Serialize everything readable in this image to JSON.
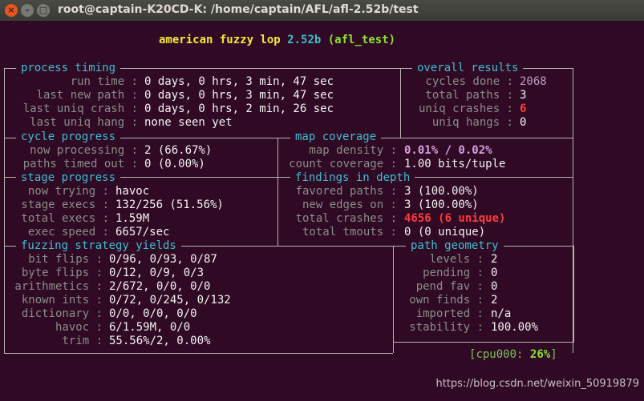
{
  "window": {
    "title": "root@captain-K20CD-K: /home/captain/AFL/afl-2.52b/test",
    "close_glyph": "×",
    "min_glyph": "–",
    "max_glyph": "□"
  },
  "banner": {
    "app": "american fuzzy lop",
    "version": "2.52b",
    "target": "(afl_test)"
  },
  "sections": {
    "process_timing": "process timing",
    "overall_results": "overall results",
    "cycle_progress": "cycle progress",
    "map_coverage": "map coverage",
    "stage_progress": "stage progress",
    "findings_in_depth": "findings in depth",
    "fuzzing_strategy_yields": "fuzzing strategy yields",
    "path_geometry": "path geometry"
  },
  "process_timing": {
    "run_time_label": "run time :",
    "run_time": "0 days, 0 hrs, 3 min, 47 sec",
    "last_new_path_label": "last new path :",
    "last_new_path": "0 days, 0 hrs, 3 min, 47 sec",
    "last_uniq_crash_label": "last uniq crash :",
    "last_uniq_crash": "0 days, 0 hrs, 2 min, 26 sec",
    "last_uniq_hang_label": "last uniq hang :",
    "last_uniq_hang": "none seen yet"
  },
  "overall_results": {
    "cycles_done_label": "cycles done :",
    "cycles_done": "2068",
    "total_paths_label": "total paths :",
    "total_paths": "3",
    "uniq_crashes_label": "uniq crashes :",
    "uniq_crashes": "6",
    "uniq_hangs_label": "uniq hangs :",
    "uniq_hangs": "0"
  },
  "cycle_progress": {
    "now_processing_label": "now processing :",
    "now_processing": "2 (66.67%)",
    "paths_timed_out_label": "paths timed out :",
    "paths_timed_out": "0 (0.00%)"
  },
  "map_coverage": {
    "map_density_label": "map density :",
    "map_density": "0.01% / 0.02%",
    "count_coverage_label": "count coverage :",
    "count_coverage": "1.00 bits/tuple"
  },
  "stage_progress": {
    "now_trying_label": "now trying :",
    "now_trying": "havoc",
    "stage_execs_label": "stage execs :",
    "stage_execs": "132/256 (51.56%)",
    "total_execs_label": "total execs :",
    "total_execs": "1.59M",
    "exec_speed_label": "exec speed :",
    "exec_speed": "6657/sec"
  },
  "findings_in_depth": {
    "favored_paths_label": "favored paths :",
    "favored_paths": "3 (100.00%)",
    "new_edges_on_label": "new edges on :",
    "new_edges_on": "3 (100.00%)",
    "total_crashes_label": "total crashes :",
    "total_crashes": "4656 (6 unique)",
    "total_tmouts_label": "total tmouts :",
    "total_tmouts": "0 (0 unique)"
  },
  "fuzzing_strategy_yields": {
    "bit_flips_label": "bit flips :",
    "bit_flips": "0/96, 0/93, 0/87",
    "byte_flips_label": "byte flips :",
    "byte_flips": "0/12, 0/9, 0/3",
    "arithmetics_label": "arithmetics :",
    "arithmetics": "2/672, 0/0, 0/0",
    "known_ints_label": "known ints :",
    "known_ints": "0/72, 0/245, 0/132",
    "dictionary_label": "dictionary :",
    "dictionary": "0/0, 0/0, 0/0",
    "havoc_label": "havoc :",
    "havoc": "6/1.59M, 0/0",
    "trim_label": "trim :",
    "trim": "55.56%/2, 0.00%"
  },
  "path_geometry": {
    "levels_label": "levels :",
    "levels": "2",
    "pending_label": "pending :",
    "pending": "0",
    "pend_fav_label": "pend fav :",
    "pend_fav": "0",
    "own_finds_label": "own finds :",
    "own_finds": "2",
    "imported_label": "imported :",
    "imported": "n/a",
    "stability_label": "stability :",
    "stability": "100.00%"
  },
  "cpu": {
    "open": "[",
    "label": "cpu000:",
    "value": "26%",
    "close": "]"
  },
  "watermark": "https://blog.csdn.net/weixin_50919879"
}
